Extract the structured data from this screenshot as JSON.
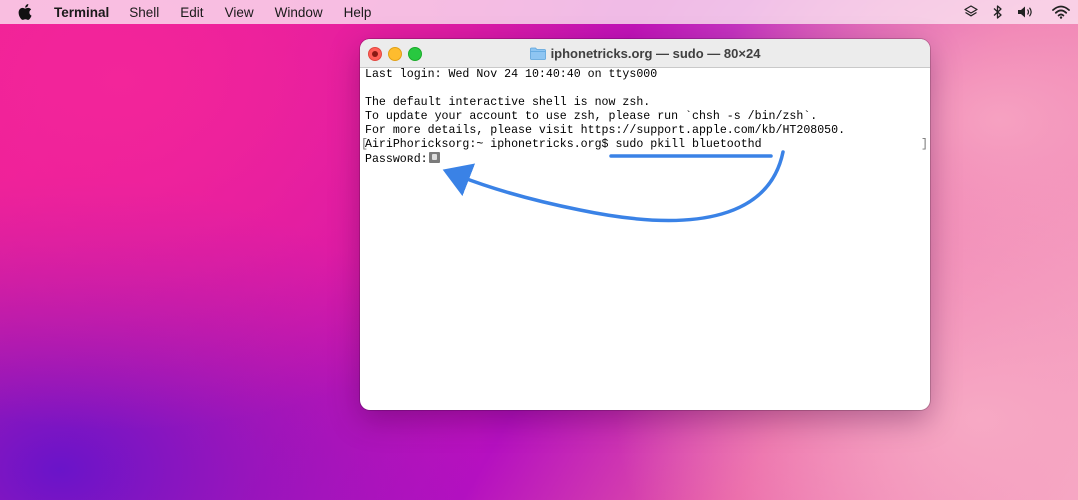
{
  "menubar": {
    "app_name": "Terminal",
    "items": [
      "Shell",
      "Edit",
      "View",
      "Window",
      "Help"
    ],
    "status_icons": [
      "layers-icon",
      "bluetooth-icon",
      "volume-icon",
      "wifi-icon"
    ]
  },
  "window": {
    "title": "iphonetricks.org — sudo — 80×24",
    "title_icon": "folder-icon"
  },
  "terminal": {
    "lines": [
      "Last login: Wed Nov 24 10:40:40 on ttys000",
      "",
      "The default interactive shell is now zsh.",
      "To update your account to use zsh, please run `chsh -s /bin/zsh`.",
      "For more details, please visit https://support.apple.com/kb/HT208050."
    ],
    "prompt": "AiriPhoricksorg:~ iphonetricks.org$ ",
    "command": "sudo pkill bluetoothd",
    "password_prompt": "Passwoʀd:"
  },
  "annotation": {
    "color": "#3a82e6",
    "icons": [
      "underline-highlight",
      "curved-arrow-icon"
    ]
  },
  "colors": {
    "close": "#ff5f57",
    "minimize": "#febc2e",
    "maximize": "#28c840",
    "terminal_bg": "#ffffff"
  }
}
